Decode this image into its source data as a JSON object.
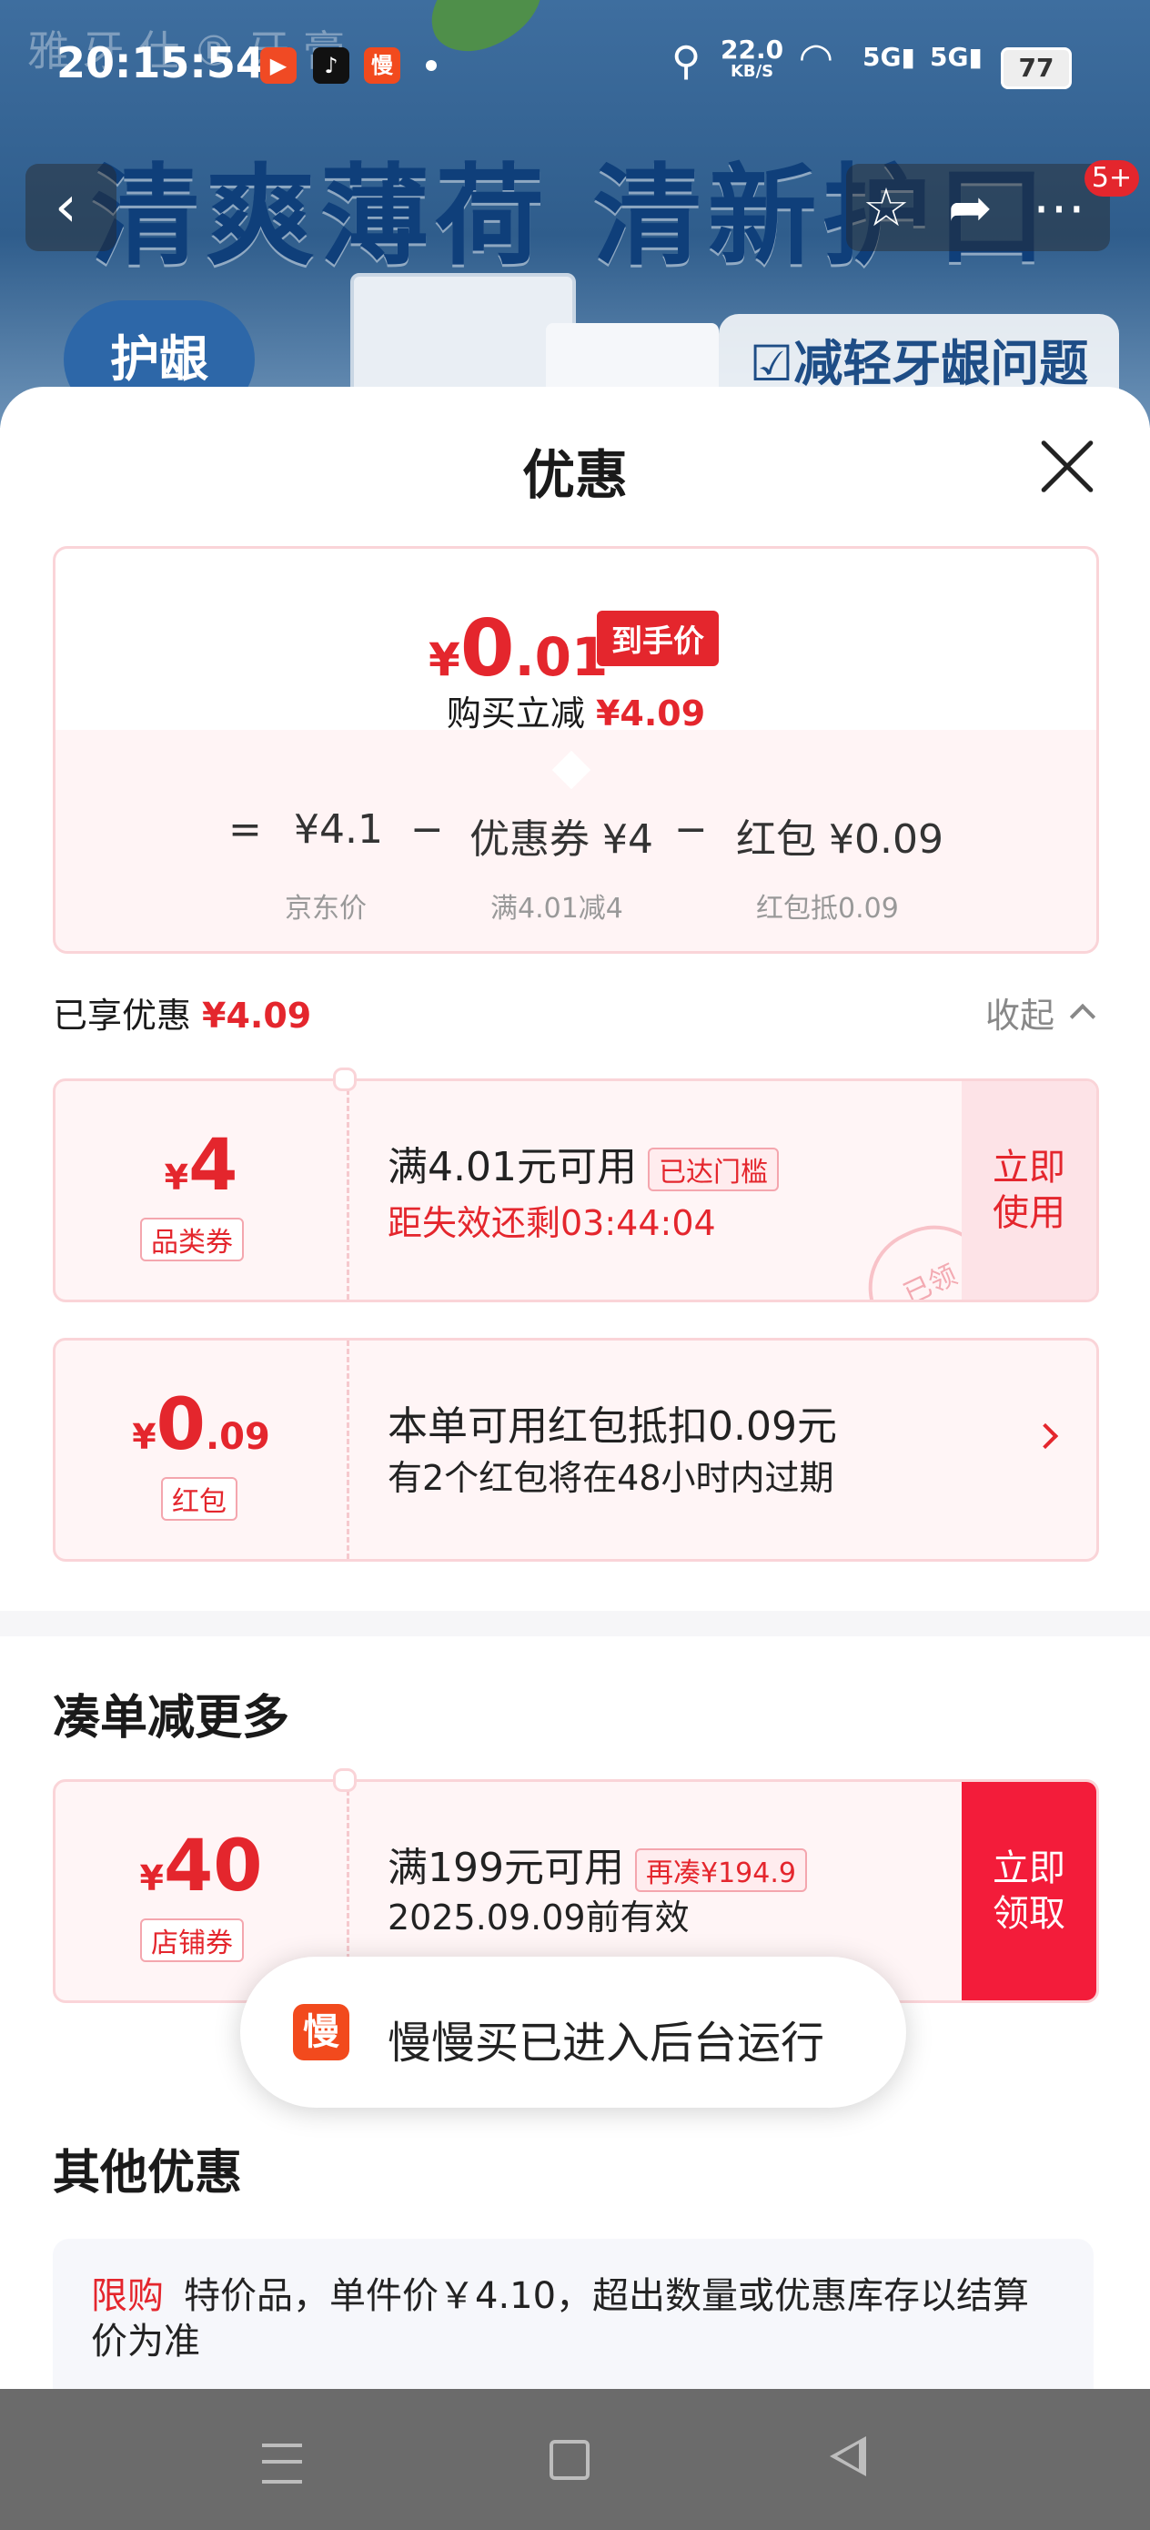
{
  "status_bar": {
    "time": "20:15:54",
    "speed": "22.0",
    "speed_unit": "KB/S",
    "battery": "77",
    "network_1": "5G",
    "network_2": "5G",
    "app_icon_3_text": "慢"
  },
  "banner": {
    "brand_ghost": "雅 牙 仕 ® 牙 膏",
    "headline": "清爽薄荷 清新护口",
    "badge": "护龈",
    "feature": "☑减轻牙龈问题",
    "notification_count": "5+"
  },
  "sheet": {
    "title": "优惠",
    "summary": {
      "currency": "¥",
      "price_int": "0",
      "price_dec": ".01",
      "price_tag": "到手价",
      "reduce_label": "购买立减",
      "reduce_amount": "¥4.09",
      "formula": {
        "eq": "=",
        "jd_price": "¥4.1",
        "minus": "−",
        "coupon": "优惠券 ¥4",
        "redpacket": "红包 ¥0.09",
        "jd_price_label": "京东价",
        "coupon_label": "满4.01减4",
        "redpacket_label": "红包抵0.09"
      }
    },
    "enjoyed": {
      "label": "已享优惠",
      "amount": "¥4.09",
      "collapse": "收起"
    },
    "coupons": [
      {
        "currency": "¥",
        "amount": "4",
        "amount_dec": "",
        "type": "品类券",
        "main": "满4.01元可用",
        "chip": "已达门槛",
        "sub": "距失效还剩03:44:04",
        "action": "立即使用",
        "stamp": "已领"
      },
      {
        "currency": "¥",
        "amount": "0",
        "amount_dec": ".09",
        "type": "红包",
        "main": "本单可用红包抵扣0.09元",
        "sub": "有2个红包将在48小时内过期"
      }
    ],
    "more_section": {
      "title": "凑单减更多",
      "coupon": {
        "currency": "¥",
        "amount": "40",
        "type": "店铺券",
        "main": "满199元可用",
        "chip": "再凑¥194.9",
        "sub": "2025.09.09前有效",
        "action": "立即领取"
      }
    },
    "toast": {
      "icon_text": "慢",
      "text": "慢慢买已进入后台运行"
    },
    "other_section": {
      "title": "其他优惠",
      "tag": "限购",
      "text": "特价品，单件价￥4.10，超出数量或优惠库存以结算价为准"
    }
  },
  "colors": {
    "accent": "#e4262d",
    "accent_solid": "#f31c3a",
    "card_bg": "#fff5f6",
    "card_border": "#fad4d8"
  }
}
